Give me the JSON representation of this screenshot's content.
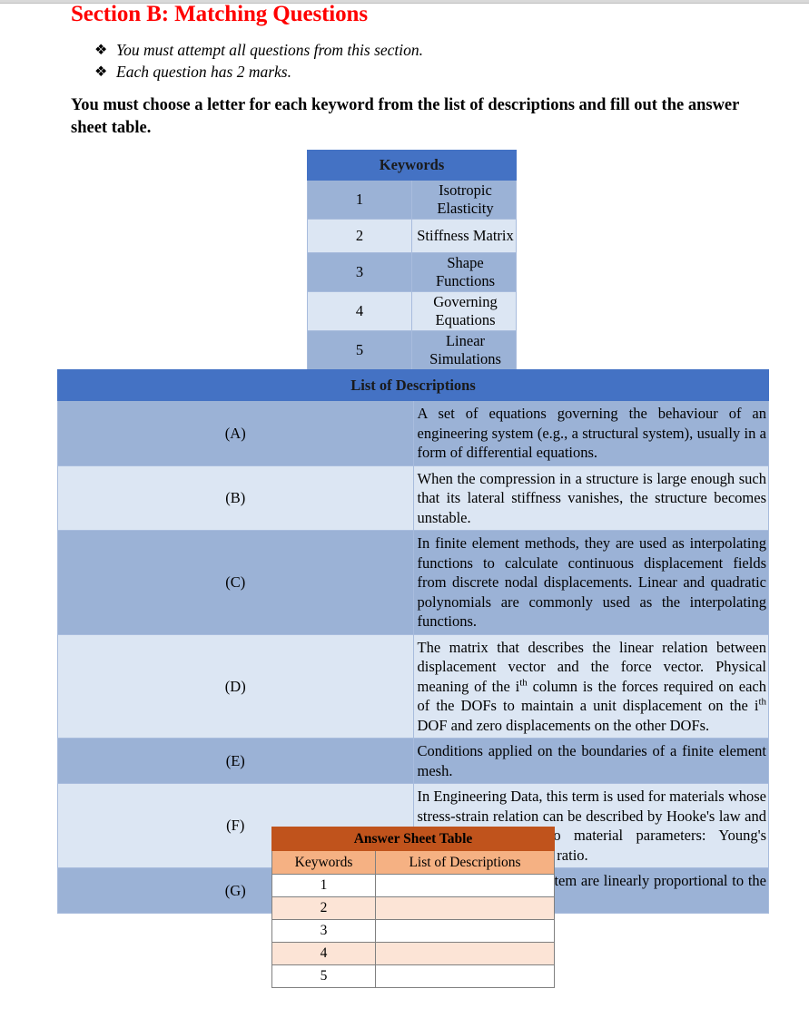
{
  "heading": {
    "title": "Section B: Matching Questions"
  },
  "bullets": {
    "glyph": "❖",
    "items": [
      {
        "text": "You must attempt all questions from this section."
      },
      {
        "text": "Each question has 2 marks."
      }
    ]
  },
  "instruction": {
    "text": "You must choose a letter for each keyword from the list of descriptions and fill out the answer sheet table."
  },
  "keywords_table": {
    "header": "Keywords",
    "rows": [
      {
        "num": "1",
        "label": "Isotropic Elasticity"
      },
      {
        "num": "2",
        "label": "Stiffness Matrix"
      },
      {
        "num": "3",
        "label": "Shape Functions"
      },
      {
        "num": "4",
        "label": "Governing Equations"
      },
      {
        "num": "5",
        "label": "Linear Simulations"
      }
    ]
  },
  "descriptions_table": {
    "header": "List of Descriptions",
    "rows": [
      {
        "letter": "(A)",
        "text": "A set of equations governing the behaviour of an engineering system (e.g., a structural system), usually in a form of differential equations."
      },
      {
        "letter": "(B)",
        "text": "When the compression in a structure is large enough such that its lateral stiffness vanishes, the structure becomes unstable."
      },
      {
        "letter": "(C)",
        "text": "In finite element methods, they are used as interpolating functions to calculate continuous displacement fields from discrete nodal displacements. Linear and quadratic polynomials are commonly used as the interpolating functions."
      },
      {
        "letter": "(D)",
        "text_part1": "The matrix that describes the linear relation between displacement vector and the force vector. Physical meaning of the i",
        "sup1": "th",
        "text_part2": " column is the forces required on each of the DOFs to maintain a unit displacement on the i",
        "sup2": "th",
        "text_part3": " DOF and zero displacements on the other DOFs."
      },
      {
        "letter": "(E)",
        "text": "Conditions applied on the boundaries of a finite element mesh."
      },
      {
        "letter": "(F)",
        "text": "In Engineering Data, this term is used for materials whose stress-strain relation can be described by Hooke's law and characterized by two material parameters: Young's modulus and Poisson's ratio."
      },
      {
        "letter": "(G)",
        "text": "The responses of a system are linearly proportional to the loads."
      }
    ]
  },
  "answer_table": {
    "title": "Answer Sheet Table",
    "columns": [
      "Keywords",
      "List of Descriptions"
    ],
    "rows": [
      {
        "keyword": "1",
        "answer": ""
      },
      {
        "keyword": "2",
        "answer": ""
      },
      {
        "keyword": "3",
        "answer": ""
      },
      {
        "keyword": "4",
        "answer": ""
      },
      {
        "keyword": "5",
        "answer": ""
      }
    ]
  },
  "colors": {
    "title_red": "#ff0000",
    "header_blue": "#4472c4",
    "row_blue_dark": "#9bb2d6",
    "row_blue_light": "#dce6f3",
    "answer_header_orange": "#c0531c",
    "answer_subheader_orange": "#f5b183",
    "answer_row_tint": "#fce4d6"
  }
}
